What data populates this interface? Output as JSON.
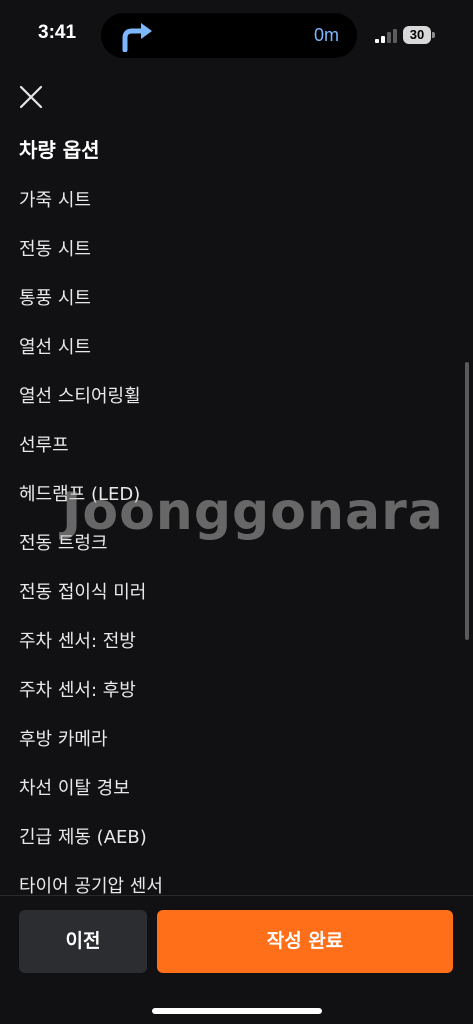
{
  "status_bar": {
    "time": "3:41",
    "nav_distance": "0m",
    "battery": "30",
    "nav_arrow_icon": "turn-right-arrow-icon",
    "signal_icon": "cellular-signal-icon"
  },
  "header": {
    "close_icon": "close-icon",
    "title": "차량 옵션"
  },
  "options": [
    "가죽 시트",
    "전동 시트",
    "통풍 시트",
    "열선 시트",
    "열선 스티어링휠",
    "선루프",
    "헤드램프 (LED)",
    "전동 트렁크",
    "전동 접이식 미러",
    "주차 센서: 전방",
    "주차 센서: 후방",
    "후방 카메라",
    "차선 이탈 경보",
    "긴급 제동 (AEB)",
    "타이어 공기압 센서"
  ],
  "watermark": "Joonggonara",
  "footer": {
    "prev_label": "이전",
    "complete_label": "작성 완료"
  },
  "colors": {
    "background": "#111113",
    "accent": "#ff6f1a",
    "secondary_button": "#2b2d31",
    "nav_distance": "#7db8ff"
  }
}
